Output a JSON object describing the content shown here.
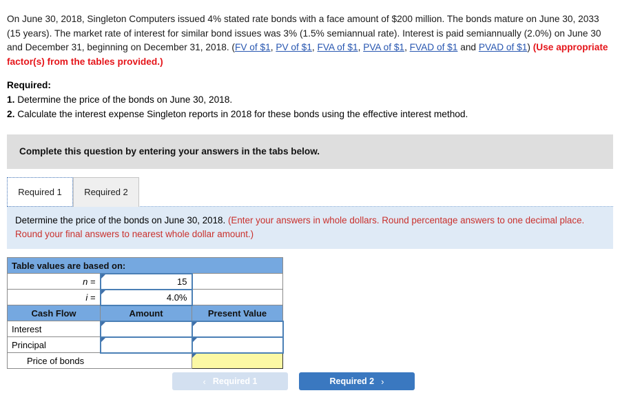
{
  "problem": {
    "segment_1": "On June 30, 2018, Singleton Computers issued 4% stated rate bonds with a face amount of $200 million. The bonds mature on June 30, 2033 (15 years). The market rate of interest for similar bond issues was 3% (1.5% semiannual rate). Interest is paid semiannually (2.0%) on June 30 and December 31, beginning on December 31, 2018. (",
    "link_fv": "FV of $1",
    "sep_1": ", ",
    "link_pv": "PV of $1",
    "sep_2": ", ",
    "link_fva": "FVA of $1",
    "sep_3": ", ",
    "link_pva": "PVA of $1",
    "sep_4": ", ",
    "link_fvad": "FVAD of $1",
    "sep_5": " and ",
    "link_pvad": "PVAD of $1",
    "sep_6": ") ",
    "red_note": "(Use appropriate factor(s) from the tables provided.)"
  },
  "required": {
    "heading": "Required:",
    "items": [
      {
        "num": "1.",
        "text": " Determine the price of the bonds on June 30, 2018."
      },
      {
        "num": "2.",
        "text": " Calculate the interest expense Singleton reports in 2018 for these bonds using the effective interest method."
      }
    ]
  },
  "instruction_bar": {
    "text": "Complete this question by entering your answers in the tabs below."
  },
  "tabs": [
    {
      "label": "Required 1",
      "active": true
    },
    {
      "label": "Required 2",
      "active": false
    }
  ],
  "blue_band": {
    "black_text": "Determine the price of the bonds on June 30, 2018. ",
    "red_text": "(Enter your answers in whole dollars. Round percentage answers to one decimal place. Round your final answers to nearest whole dollar amount.)"
  },
  "answer_table": {
    "title": "Table values are based on:",
    "n_label": "n =",
    "n_value": "15",
    "i_label": "i =",
    "i_value": "4.0%",
    "headers": [
      "Cash Flow",
      "Amount",
      "Present Value"
    ],
    "rows": [
      {
        "label": "Interest",
        "amount": "",
        "present_value": ""
      },
      {
        "label": "Principal",
        "amount": "",
        "present_value": ""
      }
    ],
    "total_label": "Price of bonds",
    "total_value": ""
  },
  "nav": {
    "prev_label": "Required 1",
    "prev_chevron": "‹",
    "next_label": "Required 2",
    "next_chevron": "›"
  },
  "colors": {
    "link": "#2756b0",
    "red_note": "#e5161b",
    "table_header_blue": "#75a8e0",
    "input_border": "#4a7fb5",
    "answer_yellow": "#fbf8a4",
    "band_blue": "#dfeaf6",
    "gray_bar": "#dedede",
    "next_button": "#3a78c0",
    "prev_button": "#d3e0f0"
  }
}
